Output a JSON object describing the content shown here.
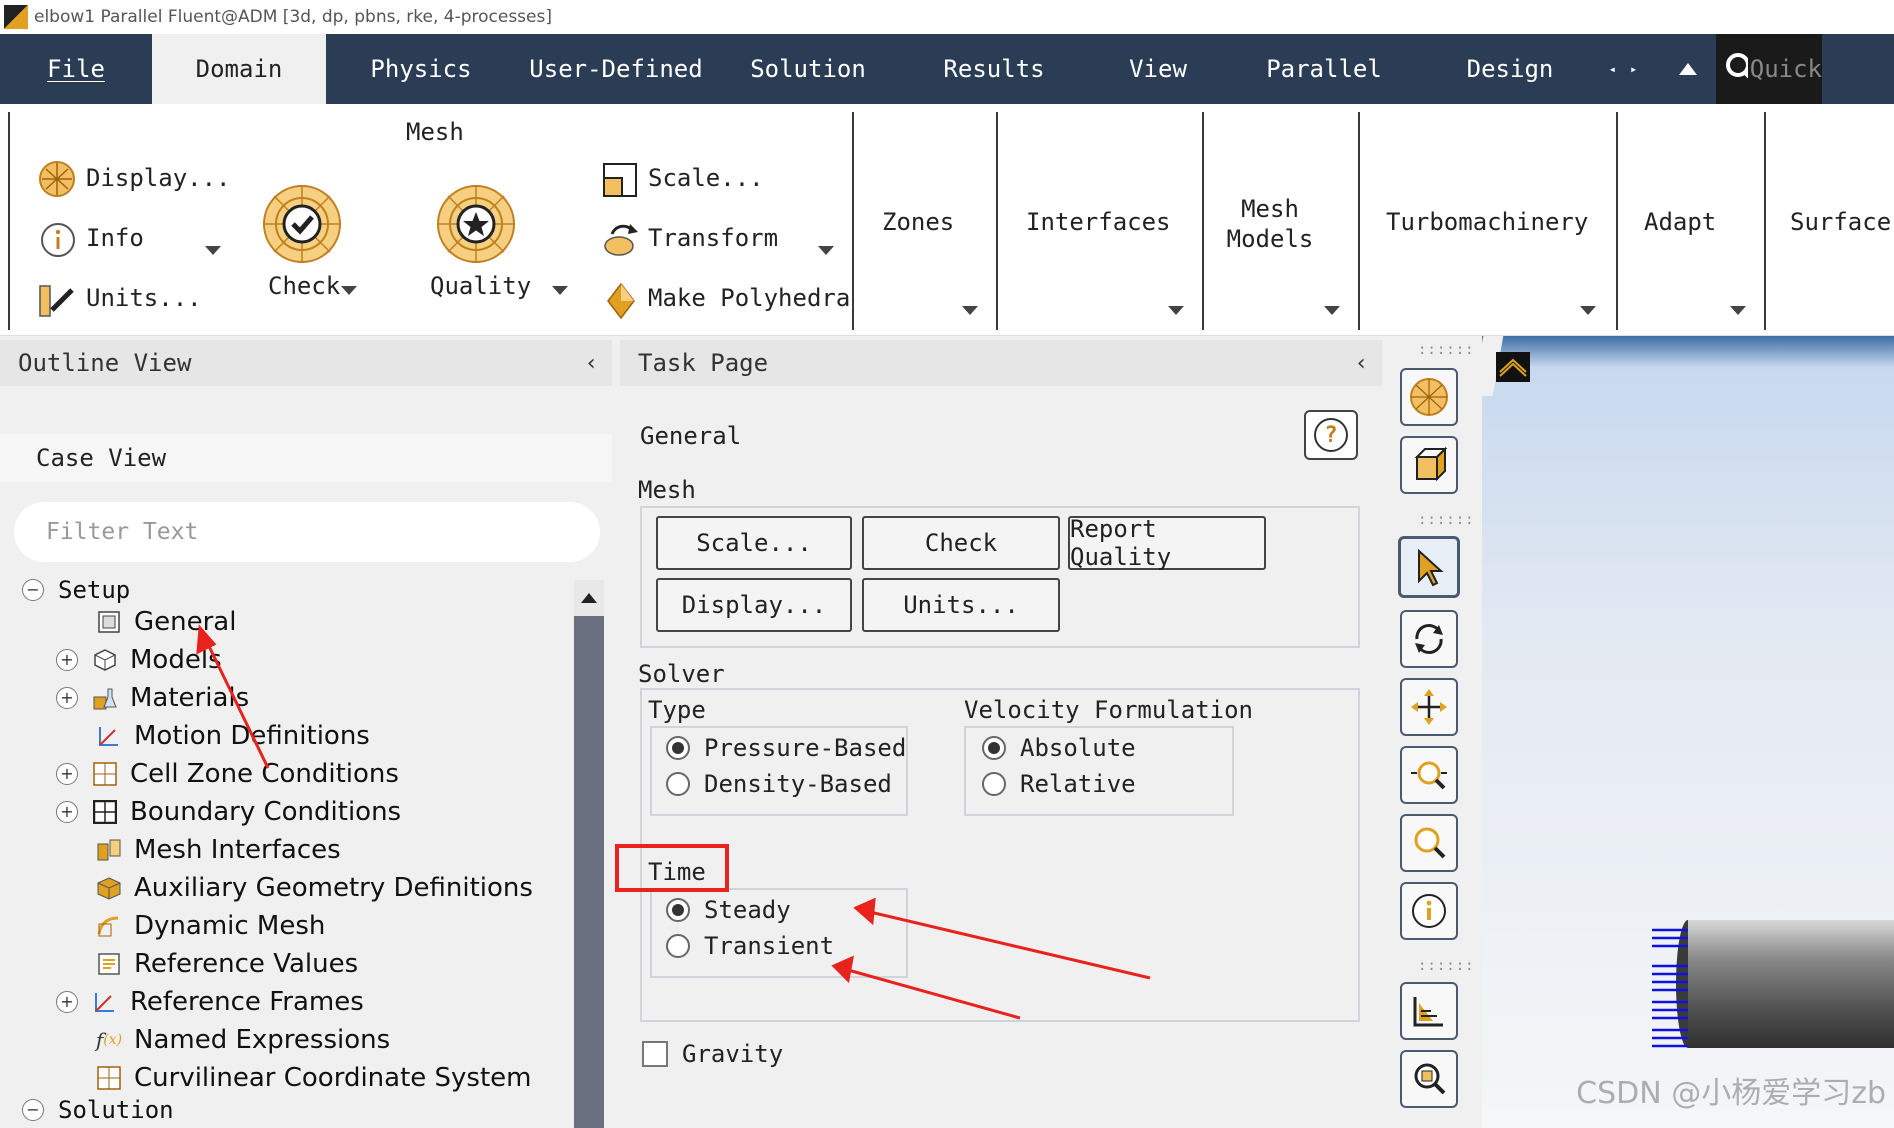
{
  "window": {
    "title": "elbow1 Parallel Fluent@ADM  [3d, dp, pbns, rke, 4-processes]"
  },
  "menubar": {
    "items": [
      "File",
      "Domain",
      "Physics",
      "User-Defined",
      "Solution",
      "Results",
      "View",
      "Parallel",
      "Design"
    ],
    "search_placeholder": "Quick"
  },
  "ribbon": {
    "mesh": {
      "title": "Mesh",
      "display": "Display...",
      "info": "Info",
      "units": "Units...",
      "check": "Check",
      "quality": "Quality",
      "scale": "Scale...",
      "transform": "Transform",
      "make_polyhedra": "Make Polyhedra"
    },
    "zones": "Zones",
    "interfaces": "Interfaces",
    "mesh_models_line1": "Mesh",
    "mesh_models_line2": "Models",
    "turbomachinery": "Turbomachinery",
    "adapt": "Adapt",
    "surface": "Surface"
  },
  "outline": {
    "title": "Outline View",
    "case_view": "Case View",
    "filter_placeholder": "Filter Text",
    "tree": {
      "setup": "Setup",
      "items": [
        "General",
        "Models",
        "Materials",
        "Motion Definitions",
        "Cell Zone Conditions",
        "Boundary Conditions",
        "Mesh Interfaces",
        "Auxiliary Geometry Definitions",
        "Dynamic Mesh",
        "Reference Values",
        "Reference Frames",
        "Named Expressions",
        "Curvilinear Coordinate System"
      ],
      "solution": "Solution"
    }
  },
  "task": {
    "title": "Task Page",
    "heading": "General",
    "help": "?",
    "mesh_label": "Mesh",
    "buttons": {
      "scale": "Scale...",
      "check": "Check",
      "report_quality": "Report Quality",
      "display": "Display...",
      "units": "Units..."
    },
    "solver_label": "Solver",
    "type_label": "Type",
    "type_options": [
      "Pressure-Based",
      "Density-Based"
    ],
    "type_selected": "Pressure-Based",
    "velocity_label": "Velocity Formulation",
    "velocity_options": [
      "Absolute",
      "Relative"
    ],
    "velocity_selected": "Absolute",
    "time_label": "Time",
    "time_options": [
      "Steady",
      "Transient"
    ],
    "time_selected": "Steady",
    "gravity_label": "Gravity",
    "gravity_checked": false
  },
  "watermark": "CSDN @小杨爱学习zb",
  "colors": {
    "menubar": "#2a3d55",
    "highlight": "#e8221c",
    "accent_icon": "#e0a020"
  }
}
